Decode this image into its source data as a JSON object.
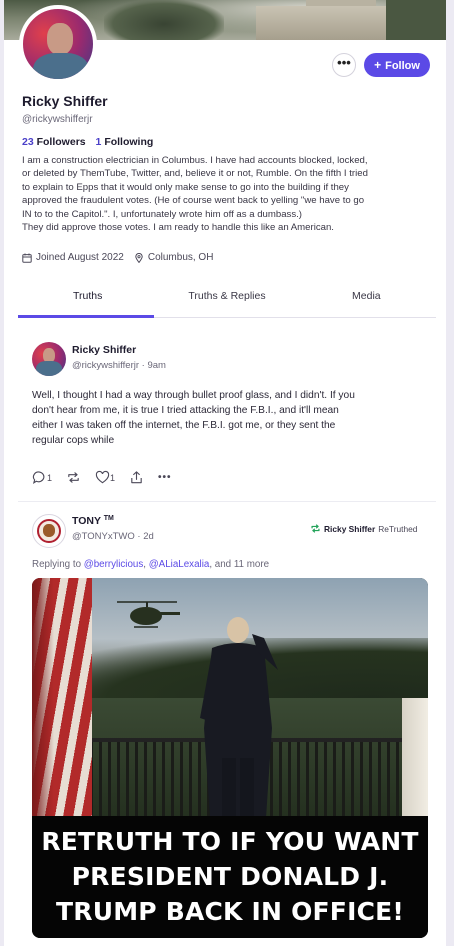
{
  "profile": {
    "name": "Ricky Shiffer",
    "handle": "@rickywshifferjr",
    "followers_count": "23",
    "followers_label": "Followers",
    "following_count": "1",
    "following_label": "Following",
    "bio_lines": [
      "I am a construction electrician in Columbus. I have had accounts blocked, locked,",
      "or deleted by ThemTube, Twitter, and, believe it or not, Rumble. On the fifth I tried",
      "to explain to Epps that it would only make sense to go into the building if they",
      "approved the fraudulent votes. (He of course went back to yelling \"we have to go",
      "IN to to the Capitol.\". I, unfortunately wrote him off as a dumbass.)",
      "They did approve those votes. I am ready to handle this like an American."
    ],
    "joined": "Joined August 2022",
    "location": "Columbus, OH",
    "more_label": "•••",
    "follow_label": "Follow",
    "follow_icon": "+"
  },
  "tabs": [
    {
      "label": "Truths",
      "active": true
    },
    {
      "label": "Truths & Replies",
      "active": false
    },
    {
      "label": "Media",
      "active": false
    }
  ],
  "posts": [
    {
      "author": "Ricky Shiffer",
      "handle_time": "@rickywshifferjr · 9am",
      "text_lines": [
        "Well, I thought I had a way through bullet proof glass, and I didn't.  If you",
        "don't hear from me, it is true I tried attacking the F.B.I., and it'll mean",
        "either I was taken off the internet, the F.B.I. got me, or they sent the",
        "regular cops while"
      ],
      "replies": "1",
      "retruths": "",
      "likes": "1",
      "more_label": "•••"
    },
    {
      "author": "TONY",
      "author_mark": "TM",
      "handle_time": "@TONYxTWO · 2d",
      "retruthed_by": "Ricky Shiffer",
      "retruthed_label": "ReTruthed",
      "replying_prefix": "Replying to",
      "replying_user1": "@berrylicious",
      "replying_sep": ",",
      "replying_user2": "@ALiaLexalia",
      "replying_suffix": ", and 11 more",
      "image_caption_lines": [
        "RETRUTH TO IF YOU WANT",
        "PRESIDENT DONALD J.",
        "TRUMP BACK IN OFFICE!"
      ]
    }
  ],
  "colors": {
    "accent": "#5b4ae6",
    "text": "#1e1b2e",
    "muted": "#6a6778",
    "retruth_green": "#23a35a"
  }
}
